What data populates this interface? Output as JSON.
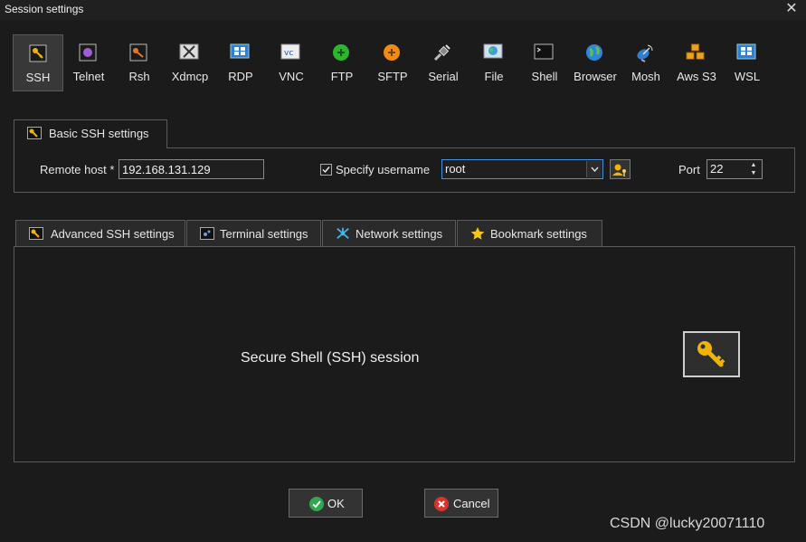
{
  "window": {
    "title": "Session settings"
  },
  "protocols": [
    {
      "label": "SSH",
      "icon": "ssh-key-icon"
    },
    {
      "label": "Telnet",
      "icon": "telnet-icon"
    },
    {
      "label": "Rsh",
      "icon": "rsh-icon"
    },
    {
      "label": "Xdmcp",
      "icon": "xdmcp-icon"
    },
    {
      "label": "RDP",
      "icon": "rdp-icon"
    },
    {
      "label": "VNC",
      "icon": "vnc-icon"
    },
    {
      "label": "FTP",
      "icon": "ftp-icon"
    },
    {
      "label": "SFTP",
      "icon": "sftp-icon"
    },
    {
      "label": "Serial",
      "icon": "serial-plug-icon"
    },
    {
      "label": "File",
      "icon": "file-icon"
    },
    {
      "label": "Shell",
      "icon": "shell-terminal-icon"
    },
    {
      "label": "Browser",
      "icon": "browser-globe-icon"
    },
    {
      "label": "Mosh",
      "icon": "mosh-satellite-icon"
    },
    {
      "label": "Aws S3",
      "icon": "aws-cubes-icon"
    },
    {
      "label": "WSL",
      "icon": "wsl-windows-icon"
    }
  ],
  "selected_protocol": "SSH",
  "basic": {
    "tab_label": "Basic SSH settings",
    "remote_host_label": "Remote host *",
    "remote_host_value": "192.168.131.129",
    "specify_username_label": "Specify username",
    "specify_username_checked": true,
    "username_value": "root",
    "port_label": "Port",
    "port_value": "22"
  },
  "advanced_tabs": [
    {
      "label": "Advanced SSH settings",
      "icon": "key-icon"
    },
    {
      "label": "Terminal settings",
      "icon": "terminal-icon"
    },
    {
      "label": "Network settings",
      "icon": "network-icon"
    },
    {
      "label": "Bookmark settings",
      "icon": "star-icon"
    }
  ],
  "content": {
    "description": "Secure Shell (SSH) session"
  },
  "buttons": {
    "ok_label": "OK",
    "cancel_label": "Cancel"
  },
  "watermark": "CSDN @lucky20071110",
  "colors": {
    "accent": "#4f8fd6",
    "key_gold": "#f0b400",
    "ok_green": "#2fa84f",
    "cancel_red": "#d9342b"
  }
}
